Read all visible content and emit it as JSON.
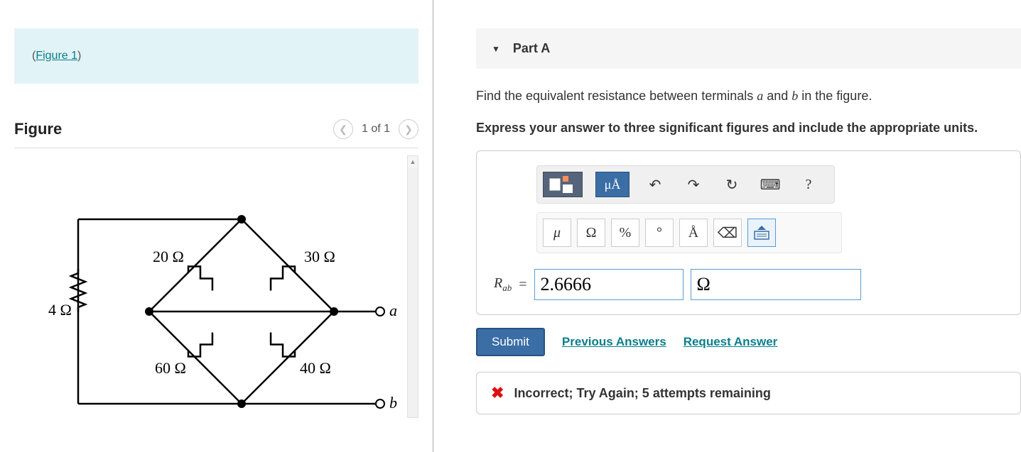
{
  "left": {
    "figure_ref": "Figure 1",
    "figure_title": "Figure",
    "pager": "1 of 1",
    "circuit": {
      "r_left": "4 Ω",
      "r_tl": "20 Ω",
      "r_tr": "30 Ω",
      "r_bl": "60 Ω",
      "r_br": "40 Ω",
      "term_a": "a",
      "term_b": "b"
    }
  },
  "right": {
    "part_title": "Part A",
    "prompt_pre": "Find the equivalent resistance between terminals ",
    "prompt_var1": "a",
    "prompt_mid": " and ",
    "prompt_var2": "b",
    "prompt_post": " in the figure.",
    "instruction": "Express your answer to three significant figures and include the appropriate units.",
    "toolbar": {
      "units_label": "μÅ",
      "help": "?"
    },
    "symbols": {
      "mu": "μ",
      "ohm": "Ω",
      "percent": "%",
      "degree": "°",
      "angstrom": "Å"
    },
    "answer": {
      "label_main": "R",
      "label_sub": "ab",
      "equals": "=",
      "value": "2.6666",
      "unit": "Ω"
    },
    "actions": {
      "submit": "Submit",
      "prev": "Previous Answers",
      "request": "Request Answer"
    },
    "feedback": "Incorrect; Try Again; 5 attempts remaining"
  }
}
